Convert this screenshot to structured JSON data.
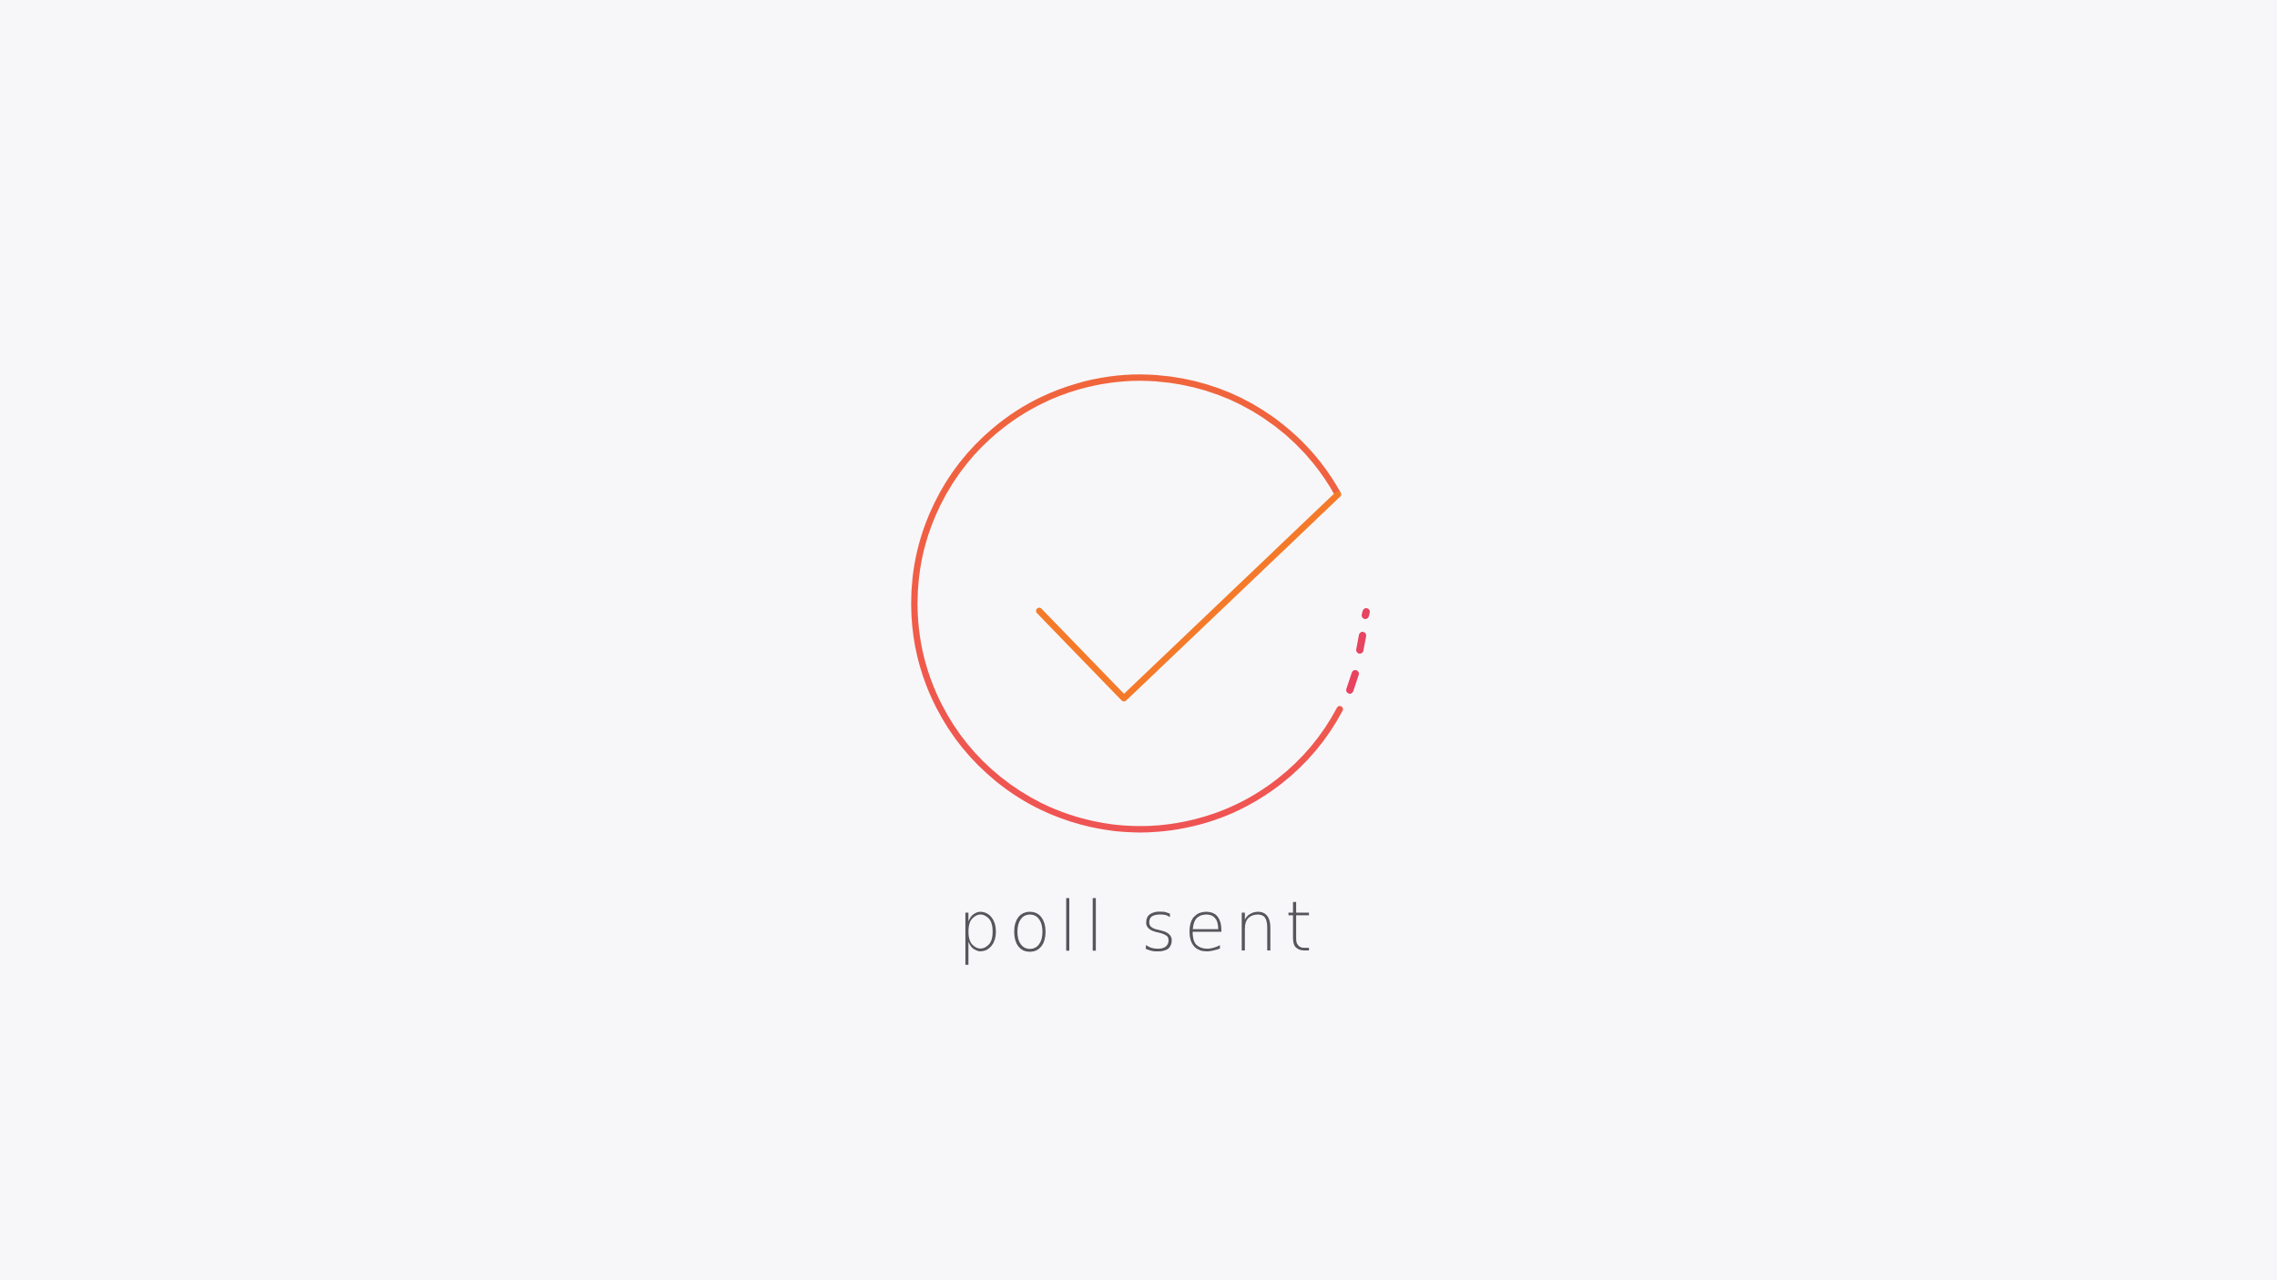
{
  "status": {
    "message": "poll sent",
    "icon": "checkmark-circle-icon"
  },
  "colors": {
    "background": "#f7f7f9",
    "accent_orange": "#f47a2a",
    "accent_coral": "#ef5a4a",
    "accent_pink": "#e8435f",
    "text": "#56565c"
  }
}
